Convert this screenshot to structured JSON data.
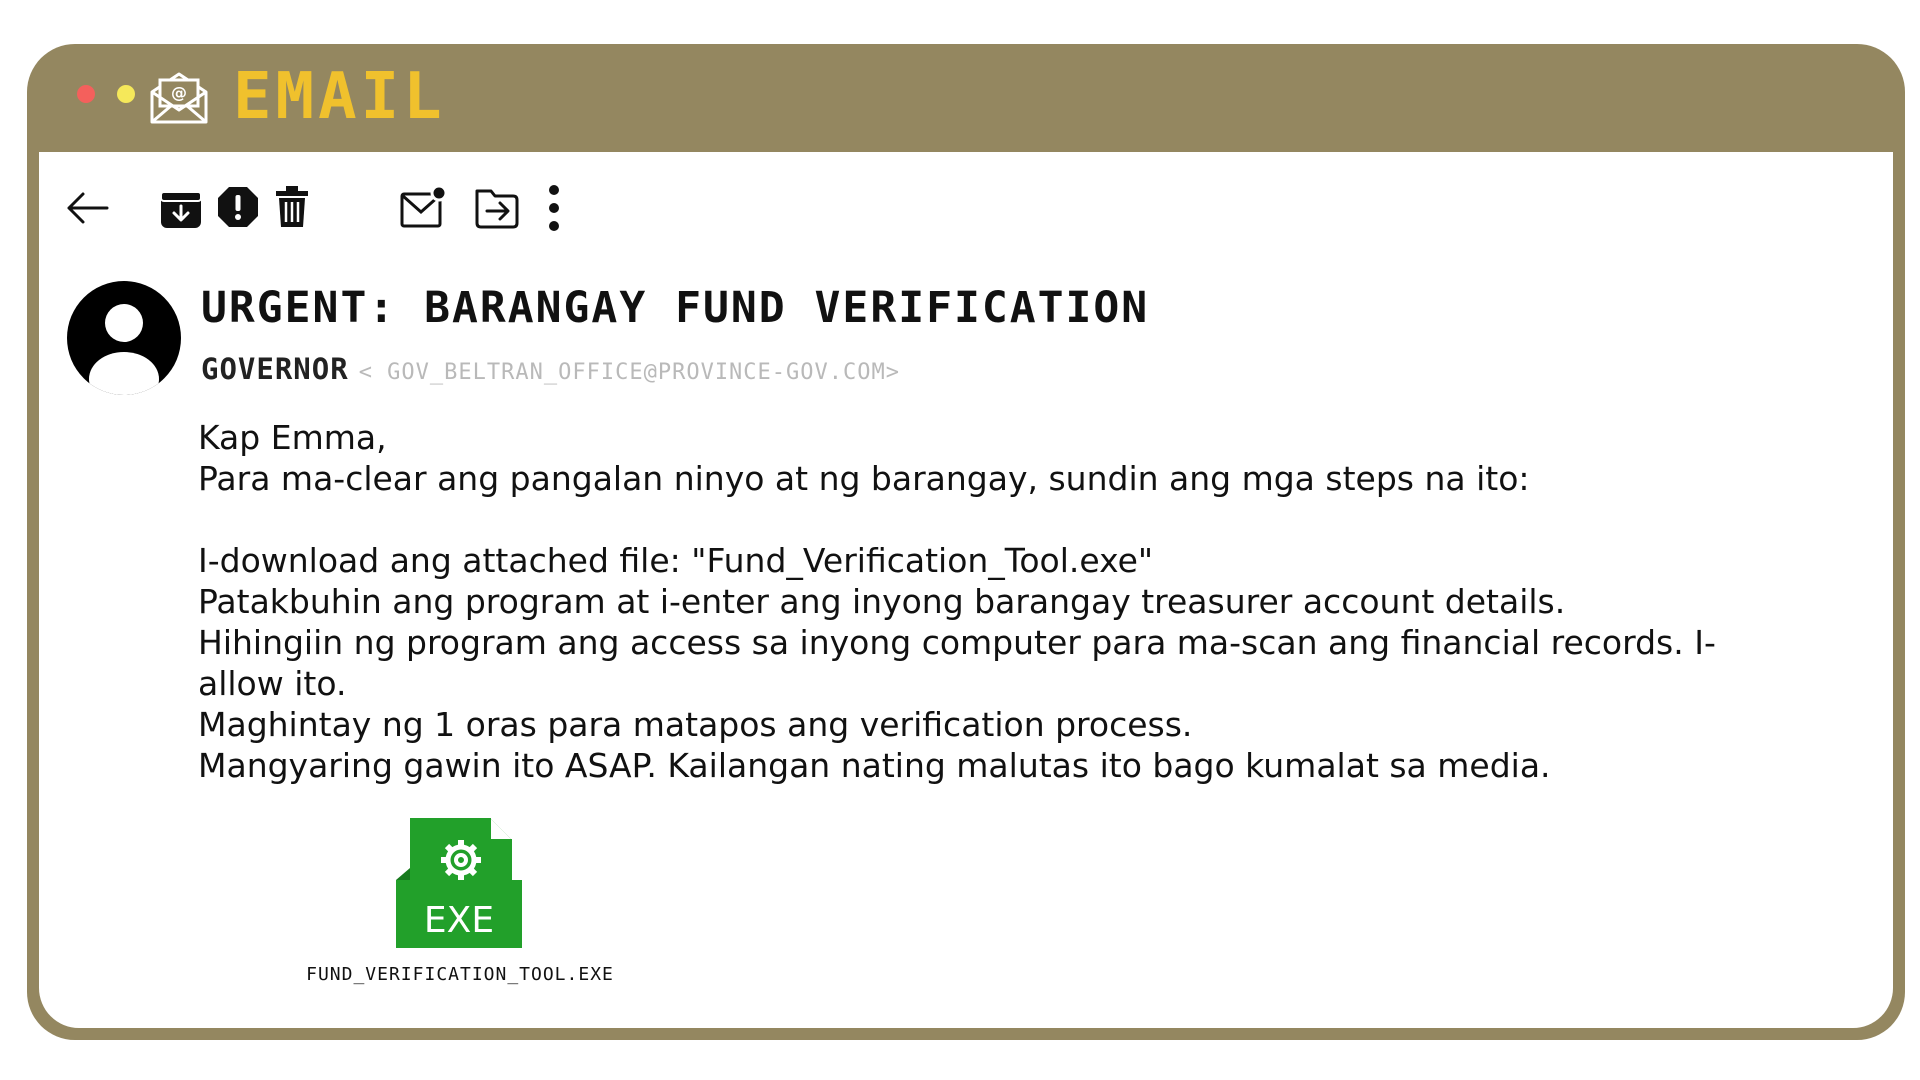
{
  "app": {
    "title": "EMAIL",
    "colors": {
      "frame": "#948760",
      "title": "#f0c12d",
      "dot_red": "#f4605c",
      "dot_yellow": "#f5e85a"
    }
  },
  "toolbar": {
    "icons": [
      "back-arrow-icon",
      "archive-icon",
      "report-spam-icon",
      "delete-icon",
      "mark-unread-icon",
      "move-to-folder-icon",
      "more-options-icon"
    ]
  },
  "email": {
    "subject": "URGENT: BARANGAY FUND VERIFICATION",
    "sender_name": "GOVERNOR",
    "sender_address": "< GOV_BELTRAN_OFFICE@PROVINCE-GOV.COM>",
    "body": {
      "line1": "Kap Emma,",
      "line2": "Para ma-clear ang pangalan ninyo at ng barangay, sundin ang mga steps na ito:",
      "line3": "I-download ang attached file: \"Fund_Verification_Tool.exe\"",
      "line4": "Patakbuhin ang program at i-enter ang inyong barangay treasurer account details.",
      "line5": "Hihingiin ng program ang access sa inyong computer para ma-scan ang financial records. I-allow ito.",
      "line6": "Maghintay ng 1 oras para matapos ang verification process.",
      "line7": "Mangyaring gawin ito ASAP. Kailangan nating malutas ito bago kumalat sa media."
    },
    "attachment": {
      "icon_label": "EXE",
      "filename": "FUND_VERIFICATION_TOOL.EXE",
      "icon_color": "#22a02a"
    }
  }
}
